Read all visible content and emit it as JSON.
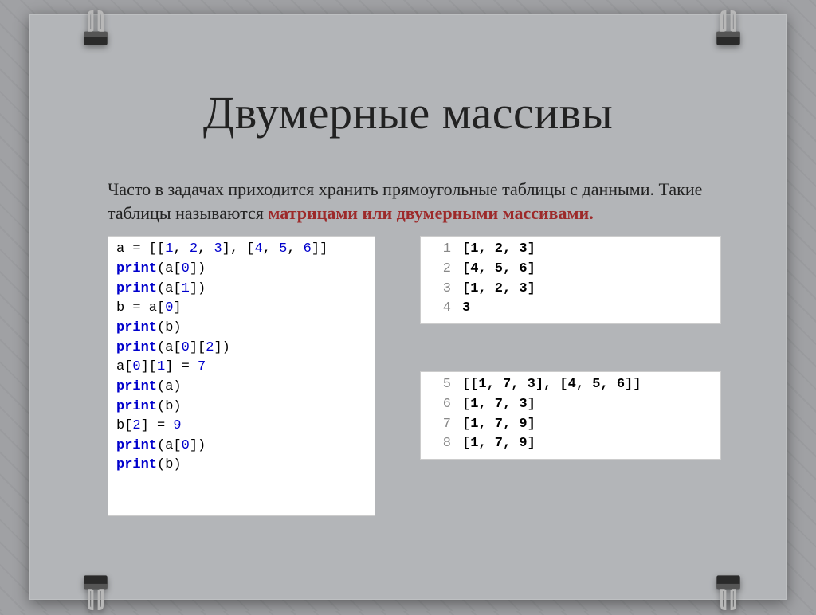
{
  "title": "Двумерные массивы",
  "paragraph": {
    "part1": "Часто в задачах приходится хранить прямоугольные таблицы с данными. Такие таблицы называются ",
    "highlight": "матрицами или двумерными массивами.",
    "part2": ""
  },
  "code_left": {
    "lines": [
      {
        "tokens": [
          {
            "t": "a ",
            "c": "plain"
          },
          {
            "t": "=",
            "c": "eq"
          },
          {
            "t": " [[",
            "c": "plain"
          },
          {
            "t": "1",
            "c": "num"
          },
          {
            "t": ", ",
            "c": "plain"
          },
          {
            "t": "2",
            "c": "num"
          },
          {
            "t": ", ",
            "c": "plain"
          },
          {
            "t": "3",
            "c": "num"
          },
          {
            "t": "], [",
            "c": "plain"
          },
          {
            "t": "4",
            "c": "num"
          },
          {
            "t": ", ",
            "c": "plain"
          },
          {
            "t": "5",
            "c": "num"
          },
          {
            "t": ", ",
            "c": "plain"
          },
          {
            "t": "6",
            "c": "num"
          },
          {
            "t": "]]",
            "c": "plain"
          }
        ]
      },
      {
        "tokens": [
          {
            "t": "print",
            "c": "kw"
          },
          {
            "t": "(a[",
            "c": "plain"
          },
          {
            "t": "0",
            "c": "num"
          },
          {
            "t": "])",
            "c": "plain"
          }
        ]
      },
      {
        "tokens": [
          {
            "t": "print",
            "c": "kw"
          },
          {
            "t": "(a[",
            "c": "plain"
          },
          {
            "t": "1",
            "c": "num"
          },
          {
            "t": "])",
            "c": "plain"
          }
        ]
      },
      {
        "tokens": [
          {
            "t": "b ",
            "c": "plain"
          },
          {
            "t": "=",
            "c": "eq"
          },
          {
            "t": " a[",
            "c": "plain"
          },
          {
            "t": "0",
            "c": "num"
          },
          {
            "t": "]",
            "c": "plain"
          }
        ]
      },
      {
        "tokens": [
          {
            "t": "print",
            "c": "kw"
          },
          {
            "t": "(b)",
            "c": "plain"
          }
        ]
      },
      {
        "tokens": [
          {
            "t": "print",
            "c": "kw"
          },
          {
            "t": "(a[",
            "c": "plain"
          },
          {
            "t": "0",
            "c": "num"
          },
          {
            "t": "][",
            "c": "plain"
          },
          {
            "t": "2",
            "c": "num"
          },
          {
            "t": "])",
            "c": "plain"
          }
        ]
      },
      {
        "tokens": [
          {
            "t": "a[",
            "c": "plain"
          },
          {
            "t": "0",
            "c": "num"
          },
          {
            "t": "][",
            "c": "plain"
          },
          {
            "t": "1",
            "c": "num"
          },
          {
            "t": "] ",
            "c": "plain"
          },
          {
            "t": "=",
            "c": "eq"
          },
          {
            "t": " ",
            "c": "plain"
          },
          {
            "t": "7",
            "c": "num"
          }
        ]
      },
      {
        "tokens": [
          {
            "t": "print",
            "c": "kw"
          },
          {
            "t": "(a)",
            "c": "plain"
          }
        ]
      },
      {
        "tokens": [
          {
            "t": "print",
            "c": "kw"
          },
          {
            "t": "(b)",
            "c": "plain"
          }
        ]
      },
      {
        "tokens": [
          {
            "t": "b[",
            "c": "plain"
          },
          {
            "t": "2",
            "c": "num"
          },
          {
            "t": "] ",
            "c": "plain"
          },
          {
            "t": "=",
            "c": "eq"
          },
          {
            "t": " ",
            "c": "plain"
          },
          {
            "t": "9",
            "c": "num"
          }
        ]
      },
      {
        "tokens": [
          {
            "t": "print",
            "c": "kw"
          },
          {
            "t": "(a[",
            "c": "plain"
          },
          {
            "t": "0",
            "c": "num"
          },
          {
            "t": "])",
            "c": "plain"
          }
        ]
      },
      {
        "tokens": [
          {
            "t": "print",
            "c": "kw"
          },
          {
            "t": "(b)",
            "c": "plain"
          }
        ]
      }
    ]
  },
  "output1": [
    {
      "n": "1",
      "v": "[1, 2, 3]"
    },
    {
      "n": "2",
      "v": "[4, 5, 6]"
    },
    {
      "n": "3",
      "v": "[1, 2, 3]"
    },
    {
      "n": "4",
      "v": "3"
    }
  ],
  "output2": [
    {
      "n": "5",
      "v": "[[1, 7, 3], [4, 5, 6]]"
    },
    {
      "n": "6",
      "v": "[1, 7, 3]"
    },
    {
      "n": "7",
      "v": "[1, 7, 9]"
    },
    {
      "n": "8",
      "v": "[1, 7, 9]"
    }
  ]
}
